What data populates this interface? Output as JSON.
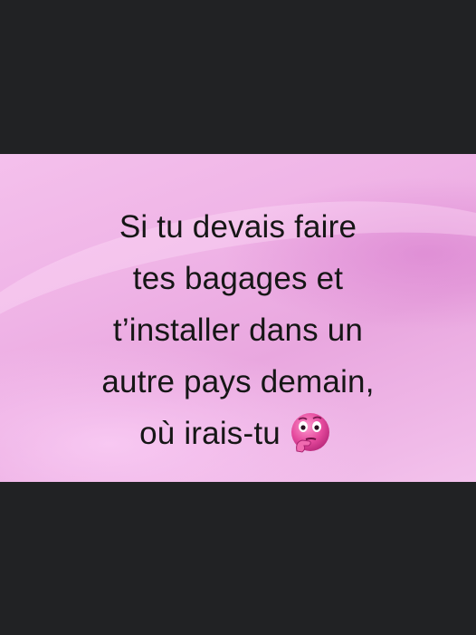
{
  "post": {
    "lines": [
      "Si tu devais faire",
      "tes bagages et",
      "t’installer dans un",
      "autre pays demain,",
      "où irais-tu"
    ],
    "emoji": "thinking-face-icon",
    "colors": {
      "card_background": "#f0b8e8",
      "frame": "#212224",
      "text": "#161616"
    }
  }
}
